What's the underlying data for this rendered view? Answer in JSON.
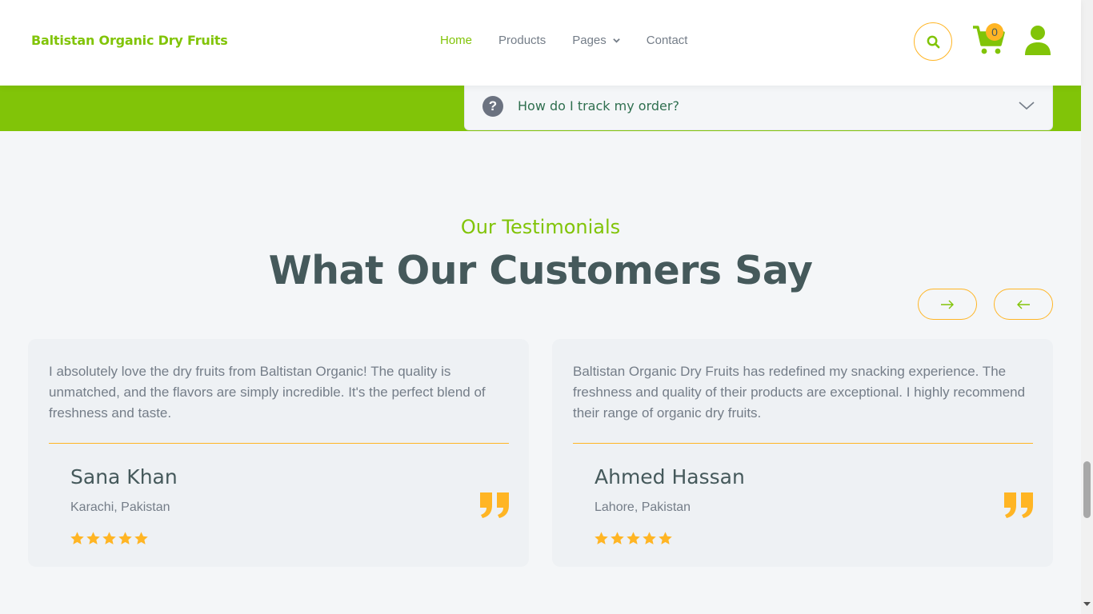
{
  "header": {
    "brand": "Baltistan Organic Dry Fruits",
    "nav": [
      {
        "label": "Home",
        "active": true
      },
      {
        "label": "Products",
        "active": false
      },
      {
        "label": "Pages",
        "active": false,
        "has_dropdown": true
      },
      {
        "label": "Contact",
        "active": false
      }
    ],
    "cart_count": "0",
    "icons": [
      "search-icon",
      "cart-icon",
      "user-icon"
    ]
  },
  "faq": {
    "question": "How do I track my order?"
  },
  "testimonials": {
    "eyebrow": "Our Testimonials",
    "heading": "What Our Customers Say",
    "items": [
      {
        "text": "I absolutely love the dry fruits from Baltistan Organic! The quality is unmatched, and the flavors are simply incredible. It's the perfect blend of freshness and taste.",
        "name": "Sana Khan",
        "location": "Karachi, Pakistan",
        "rating": 5
      },
      {
        "text": "Baltistan Organic Dry Fruits has redefined my snacking experience. The freshness and quality of their products are exceptional. I highly recommend their range of organic dry fruits.",
        "name": "Ahmed Hassan",
        "location": "Lahore, Pakistan",
        "rating": 5
      }
    ]
  },
  "colors": {
    "primary": "#81c408",
    "secondary": "#ffb524",
    "dark": "#45595b",
    "muted": "#747d88"
  }
}
